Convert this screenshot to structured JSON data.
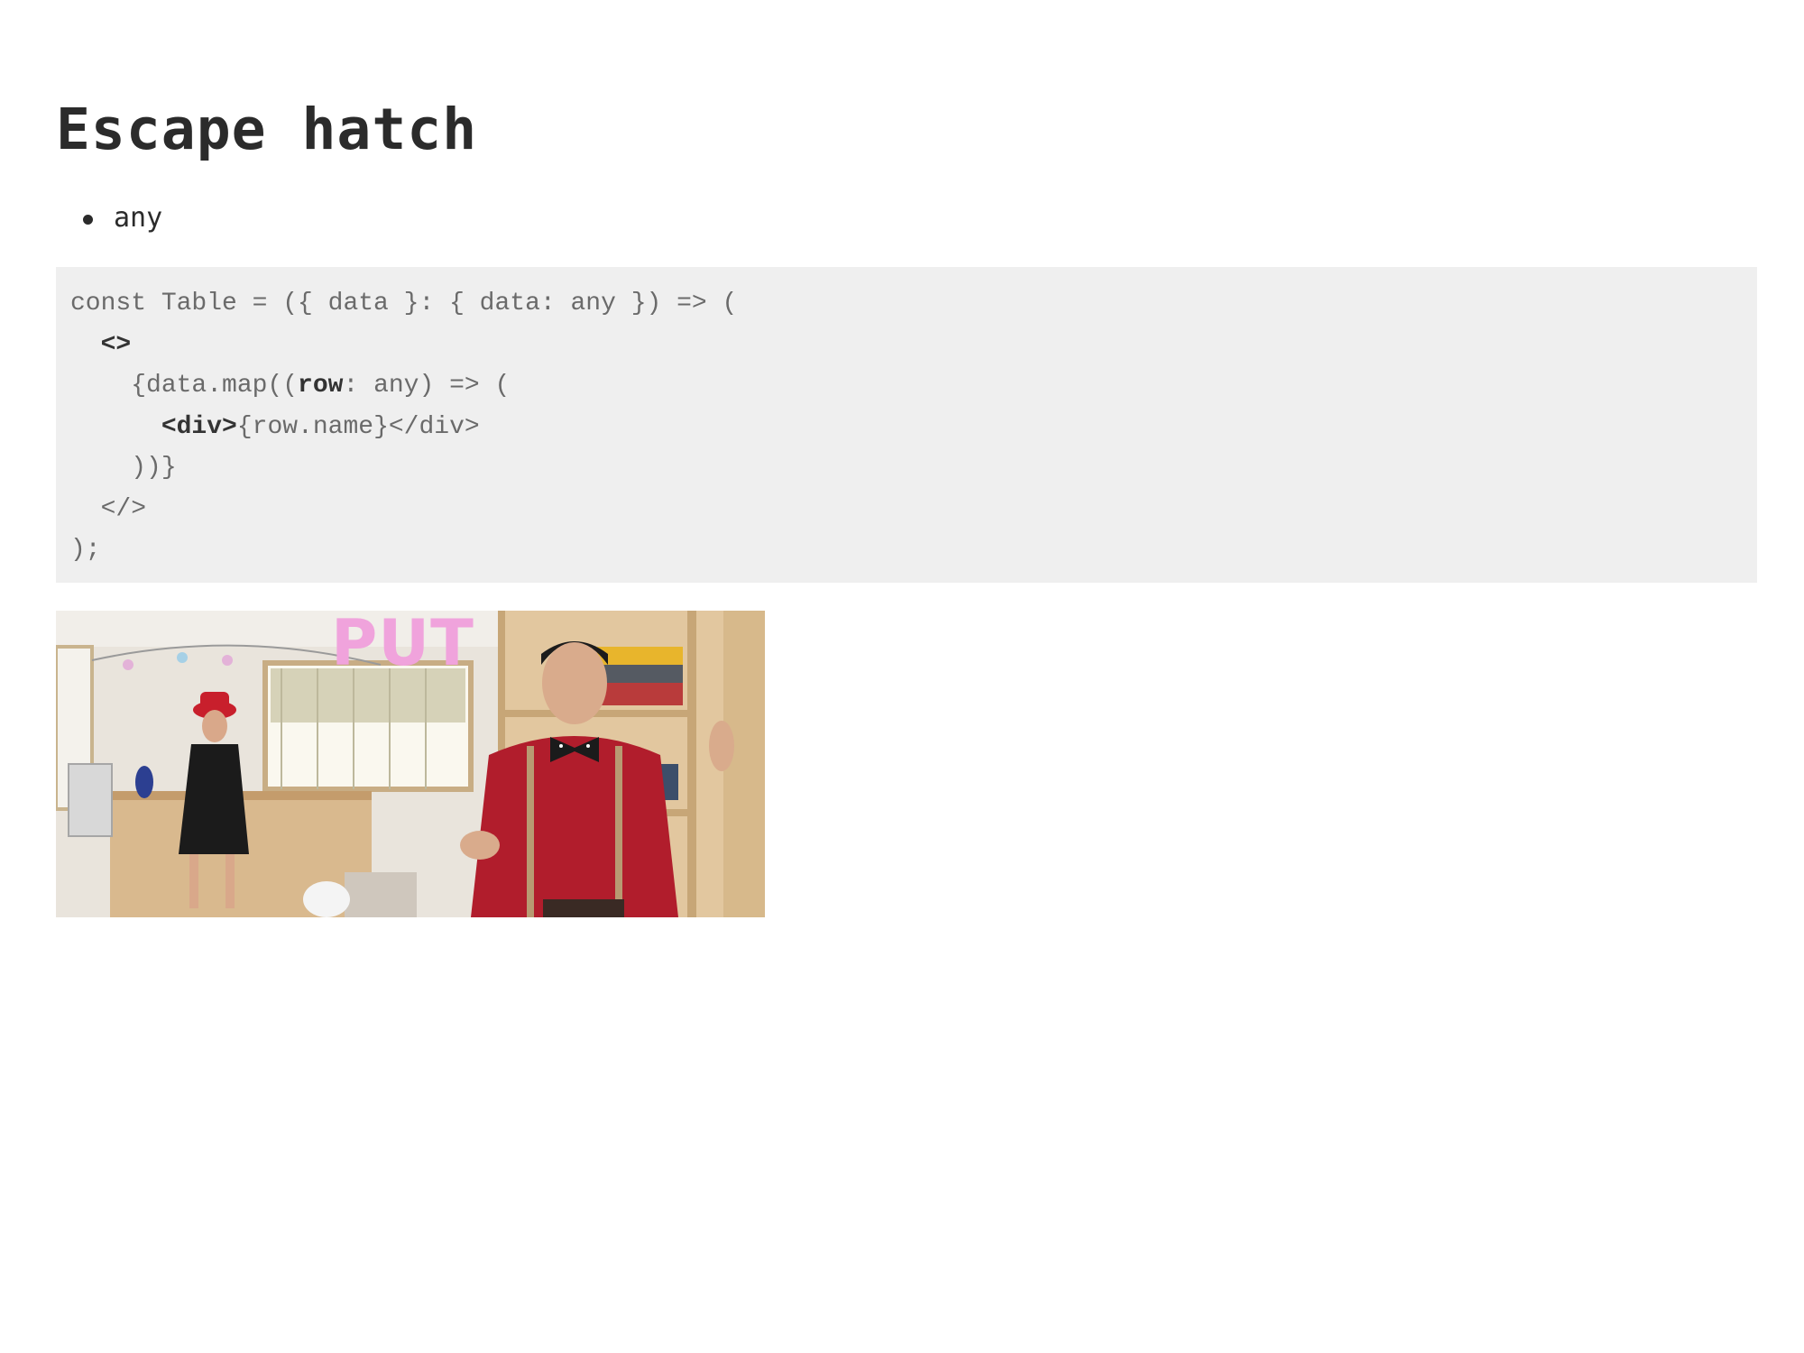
{
  "slide": {
    "title": "Escape hatch",
    "bullets": [
      {
        "text": "any"
      }
    ],
    "code": {
      "lines": [
        {
          "pre": "const Table = ({ data }: { data: any }) => (",
          "bold": "",
          "post": ""
        },
        {
          "pre": "  ",
          "bold": "<>",
          "post": ""
        },
        {
          "pre": "    {data.map((",
          "bold": "row",
          "post": ": any) => ("
        },
        {
          "pre": "      ",
          "bold": "<div>",
          "post": "{row.name}</div>"
        },
        {
          "pre": "    ))}",
          "bold": "",
          "post": ""
        },
        {
          "pre": "  </>",
          "bold": "",
          "post": ""
        },
        {
          "pre": ");",
          "bold": "",
          "post": ""
        }
      ]
    },
    "gif": {
      "caption": "PUT"
    }
  }
}
